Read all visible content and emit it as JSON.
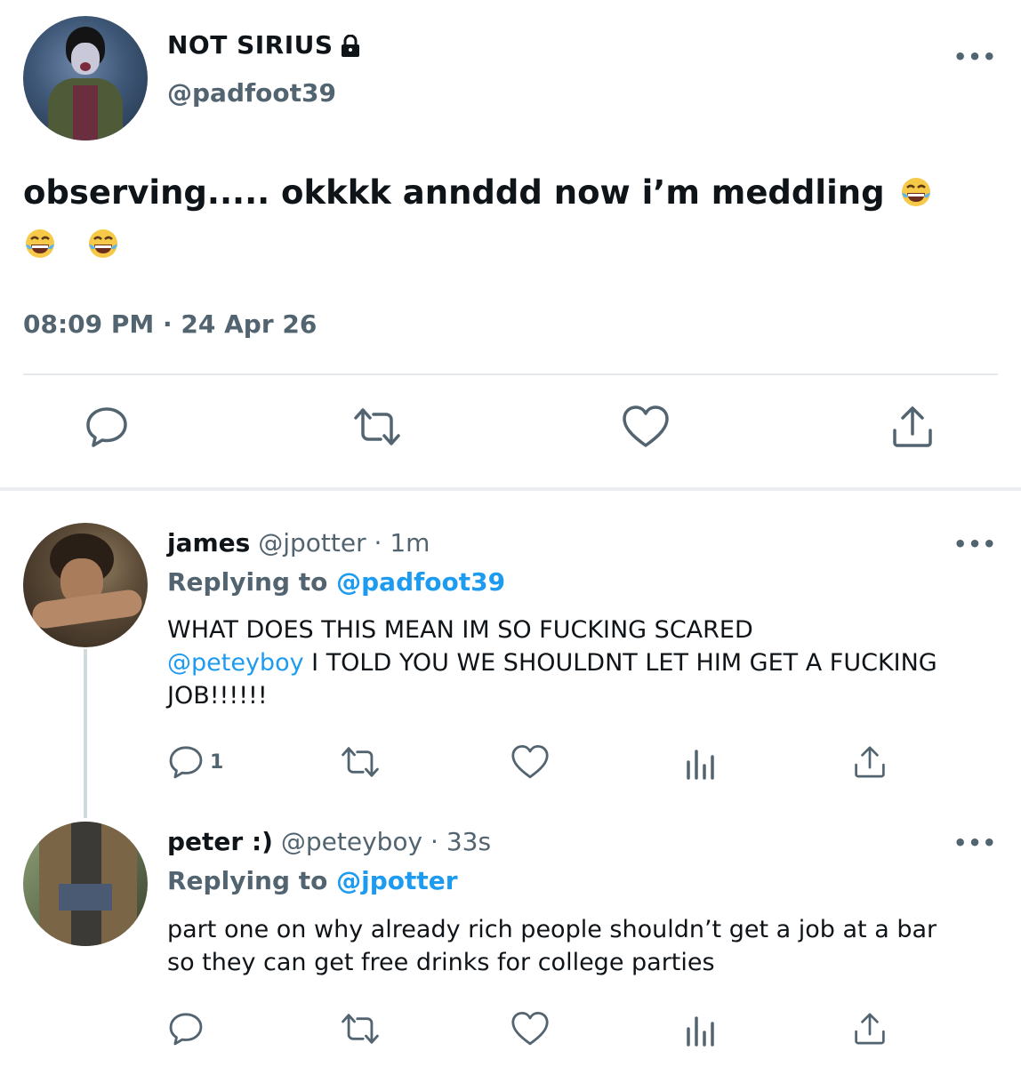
{
  "main_tweet": {
    "display_name": "NOT SIRIUS",
    "handle": "@padfoot39",
    "text": "observing..... okkkk annddd now i’m meddling",
    "timestamp": "08:09 PM · 24 Apr 26",
    "more_label": "•••",
    "actions": [
      "reply-icon",
      "retweet-icon",
      "like-icon",
      "share-icon"
    ]
  },
  "replies": [
    {
      "display_name": "james",
      "handle": "@jpotter",
      "age": "· 1m",
      "replying_prefix": "Replying to",
      "replying_to": "@padfoot39",
      "text_part1": "WHAT DOES THIS MEAN IM SO FUCKING SCARED",
      "mention": "@peteyboy",
      "text_part2": " I TOLD YOU WE SHOULDNT LET HIM GET A FUCKING JOB!!!!!!",
      "reply_count": "1",
      "more_label": "•••"
    },
    {
      "display_name": "peter :)",
      "handle": "@peteyboy",
      "age": "· 33s",
      "replying_prefix": "Replying to",
      "replying_to": "@jpotter",
      "text": "part one on why already rich people shouldn’t get a job at a bar so they can get free drinks for college parties",
      "reply_count": "",
      "more_label": "•••"
    }
  ],
  "colors": {
    "text_primary": "#0f1419",
    "text_secondary": "#536471",
    "mention": "#1d9bf0",
    "divider": "#e6e9ec"
  }
}
